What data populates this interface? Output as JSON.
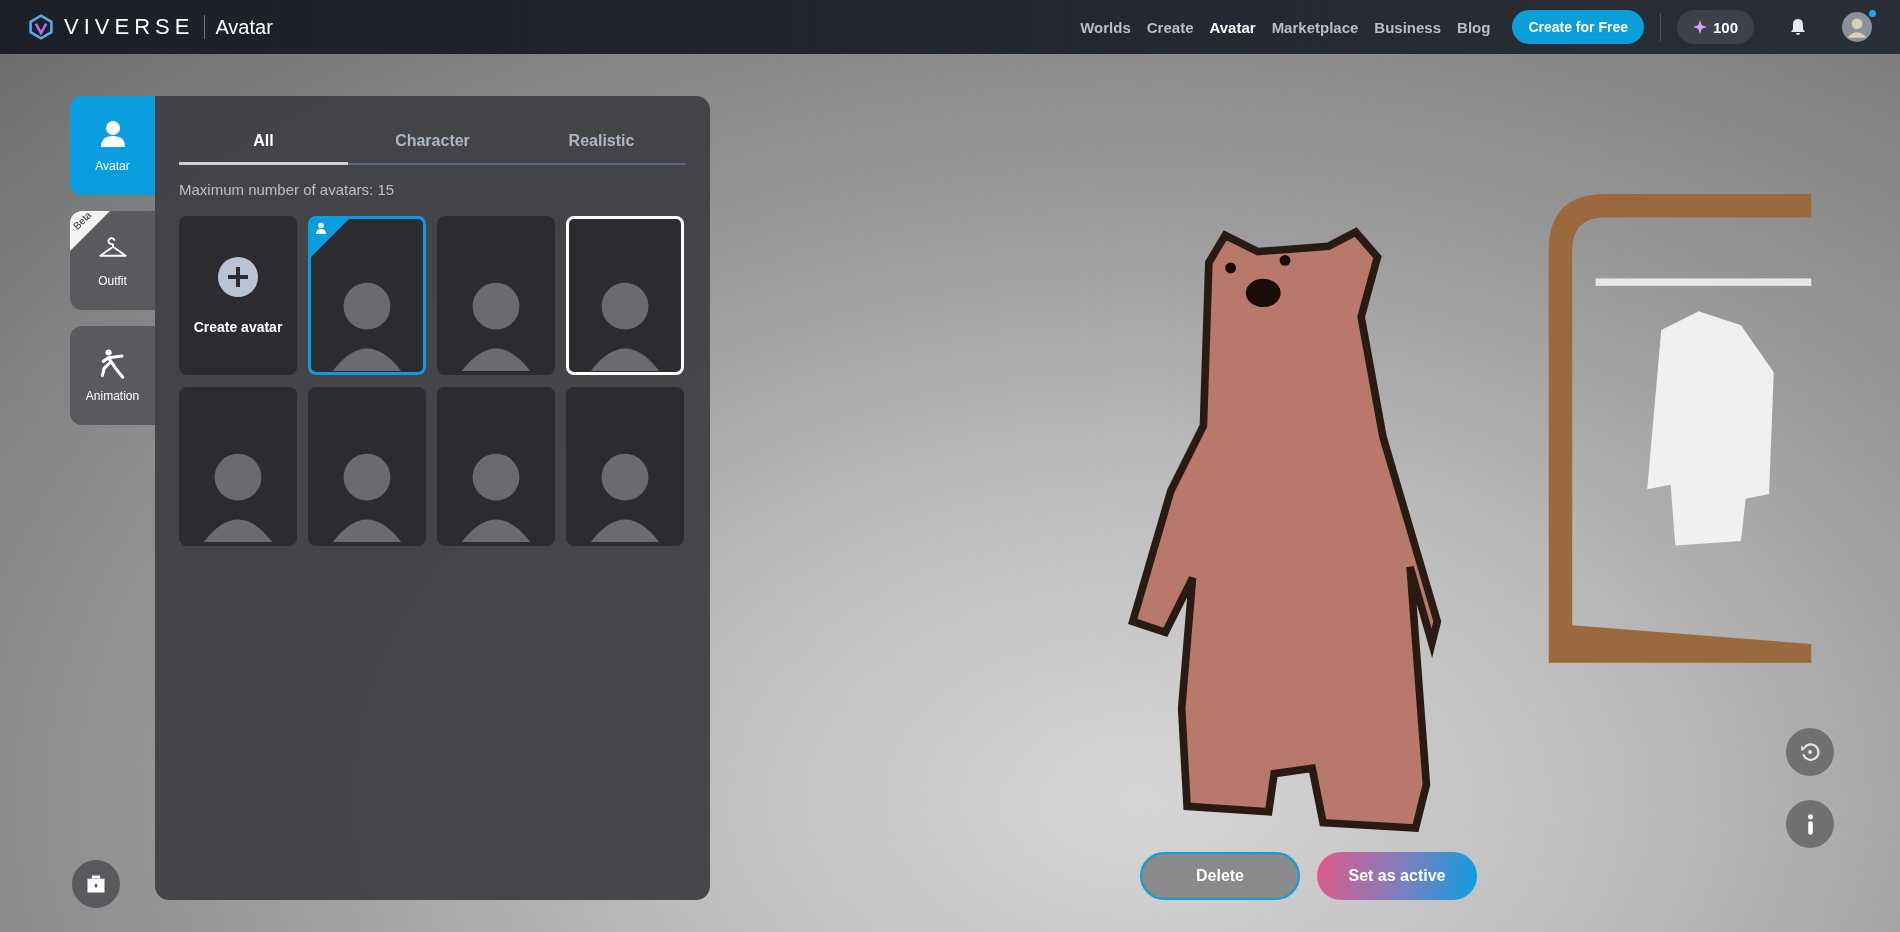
{
  "header": {
    "brand": "VIVERSE",
    "section": "Avatar",
    "nav": [
      {
        "label": "Worlds",
        "selected": false
      },
      {
        "label": "Create",
        "selected": false
      },
      {
        "label": "Avatar",
        "selected": true
      },
      {
        "label": "Marketplace",
        "selected": false
      },
      {
        "label": "Business",
        "selected": false
      },
      {
        "label": "Blog",
        "selected": false
      }
    ],
    "cta": "Create for Free",
    "credits": "100",
    "notification_dot": true
  },
  "sidebar": [
    {
      "label": "Avatar",
      "selected": true
    },
    {
      "label": "Outfit",
      "selected": false,
      "badge": "Beta"
    },
    {
      "label": "Animation",
      "selected": false
    }
  ],
  "panel": {
    "tabs": [
      {
        "label": "All",
        "selected": true
      },
      {
        "label": "Character",
        "selected": false
      },
      {
        "label": "Realistic",
        "selected": false
      }
    ],
    "limit_note": "Maximum number of avatars: 15",
    "create_label": "Create avatar",
    "avatars": [
      {
        "active": true,
        "selected": false
      },
      {
        "active": false,
        "selected": false
      },
      {
        "active": false,
        "selected": true
      },
      {
        "active": false,
        "selected": false
      },
      {
        "active": false,
        "selected": false
      },
      {
        "active": false,
        "selected": false
      },
      {
        "active": false,
        "selected": false
      }
    ]
  },
  "actions": [
    "Delete",
    "Set as active"
  ]
}
